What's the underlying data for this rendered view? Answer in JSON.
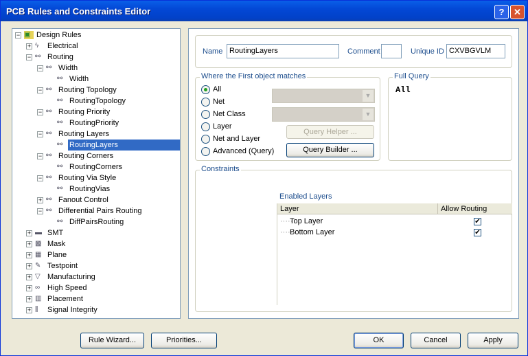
{
  "window": {
    "title": "PCB Rules and Constraints Editor",
    "help": "?",
    "close": "✕"
  },
  "tree": [
    {
      "level": 0,
      "exp": "−",
      "icon": "folder-icon",
      "label": "Design Rules"
    },
    {
      "level": 1,
      "exp": "+",
      "icon": "electrical-icon",
      "label": "Electrical"
    },
    {
      "level": 1,
      "exp": "−",
      "icon": "routing-icon",
      "label": "Routing"
    },
    {
      "level": 2,
      "exp": "−",
      "icon": "routing-icon",
      "label": "Width"
    },
    {
      "level": 3,
      "exp": "",
      "icon": "rule-icon",
      "label": "Width"
    },
    {
      "level": 2,
      "exp": "−",
      "icon": "routing-icon",
      "label": "Routing Topology"
    },
    {
      "level": 3,
      "exp": "",
      "icon": "rule-icon",
      "label": "RoutingTopology"
    },
    {
      "level": 2,
      "exp": "−",
      "icon": "routing-icon",
      "label": "Routing Priority"
    },
    {
      "level": 3,
      "exp": "",
      "icon": "rule-icon",
      "label": "RoutingPriority"
    },
    {
      "level": 2,
      "exp": "−",
      "icon": "routing-icon",
      "label": "Routing Layers"
    },
    {
      "level": 3,
      "exp": "",
      "icon": "rule-icon",
      "label": "RoutingLayers",
      "selected": true
    },
    {
      "level": 2,
      "exp": "−",
      "icon": "routing-icon",
      "label": "Routing Corners"
    },
    {
      "level": 3,
      "exp": "",
      "icon": "rule-icon",
      "label": "RoutingCorners"
    },
    {
      "level": 2,
      "exp": "−",
      "icon": "routing-icon",
      "label": "Routing Via Style"
    },
    {
      "level": 3,
      "exp": "",
      "icon": "rule-icon",
      "label": "RoutingVias"
    },
    {
      "level": 2,
      "exp": "+",
      "icon": "routing-icon",
      "label": "Fanout Control"
    },
    {
      "level": 2,
      "exp": "−",
      "icon": "routing-icon",
      "label": "Differential Pairs Routing"
    },
    {
      "level": 3,
      "exp": "",
      "icon": "rule-icon",
      "label": "DiffPairsRouting"
    },
    {
      "level": 1,
      "exp": "+",
      "icon": "smt-icon",
      "label": "SMT"
    },
    {
      "level": 1,
      "exp": "+",
      "icon": "mask-icon",
      "label": "Mask"
    },
    {
      "level": 1,
      "exp": "+",
      "icon": "plane-icon",
      "label": "Plane"
    },
    {
      "level": 1,
      "exp": "+",
      "icon": "testpoint-icon",
      "label": "Testpoint"
    },
    {
      "level": 1,
      "exp": "+",
      "icon": "manufacturing-icon",
      "label": "Manufacturing"
    },
    {
      "level": 1,
      "exp": "+",
      "icon": "high-speed-icon",
      "label": "High Speed"
    },
    {
      "level": 1,
      "exp": "+",
      "icon": "placement-icon",
      "label": "Placement"
    },
    {
      "level": 1,
      "exp": "+",
      "icon": "signal-integrity-icon",
      "label": "Signal Integrity"
    }
  ],
  "rule": {
    "name_label": "Name",
    "name": "RoutingLayers",
    "comment_label": "Comment",
    "comment": "",
    "uid_label": "Unique ID",
    "uid": "CXVBGVLM"
  },
  "match": {
    "title": "Where the First object matches",
    "options": [
      "All",
      "Net",
      "Net Class",
      "Layer",
      "Net and Layer",
      "Advanced (Query)"
    ],
    "selected": "All",
    "query_helper": "Query Helper ...",
    "query_builder": "Query Builder ..."
  },
  "full_query": {
    "title": "Full Query",
    "text": "All"
  },
  "constraints": {
    "title": "Constraints",
    "enabled_layers": "Enabled Layers",
    "col_layer": "Layer",
    "col_allow": "Allow Routing",
    "rows": [
      {
        "layer": "Top Layer",
        "allow": true
      },
      {
        "layer": "Bottom Layer",
        "allow": true
      }
    ]
  },
  "buttons": {
    "wizard": "Rule Wizard...",
    "priorities": "Priorities...",
    "ok": "OK",
    "cancel": "Cancel",
    "apply": "Apply"
  }
}
